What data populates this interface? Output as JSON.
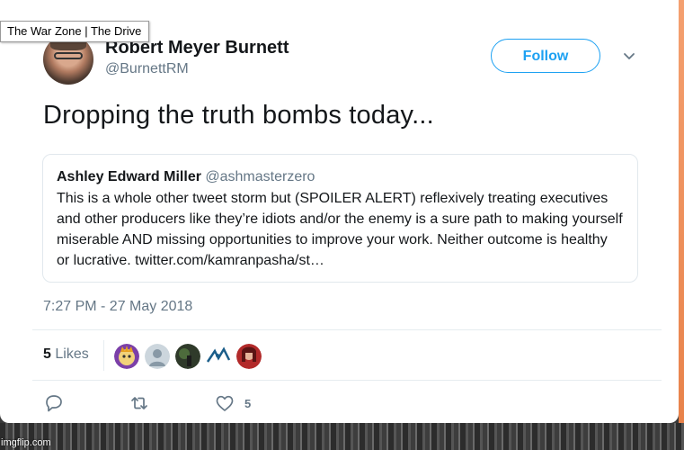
{
  "tooltip": "The War Zone | The Drive",
  "author": {
    "name": "Robert Meyer Burnett",
    "handle": "@BurnettRM"
  },
  "follow_label": "Follow",
  "tweet_text": "Dropping the truth bombs today...",
  "quoted": {
    "name": "Ashley Edward Miller",
    "handle": "@ashmasterzero",
    "text": "This is a whole other tweet storm but (SPOILER ALERT) reflexively treating executives and other producers like they’re idiots and/or the enemy is a sure path to making yourself miserable AND missing opportunities to improve your work. Neither outcome is healthy or lucrative. twitter.com/kamranpasha/st…"
  },
  "timestamp": "7:27 PM - 27 May 2018",
  "likes": {
    "count": "5",
    "label": "Likes"
  },
  "actions": {
    "like_count": "5"
  },
  "watermark": "imgflip.com",
  "colors": {
    "accent": "#1da1f2",
    "secondary_text": "#657786",
    "primary_text": "#14171a"
  },
  "icons": [
    "chevron-down-icon",
    "reply-icon",
    "retweet-icon",
    "heart-icon"
  ]
}
